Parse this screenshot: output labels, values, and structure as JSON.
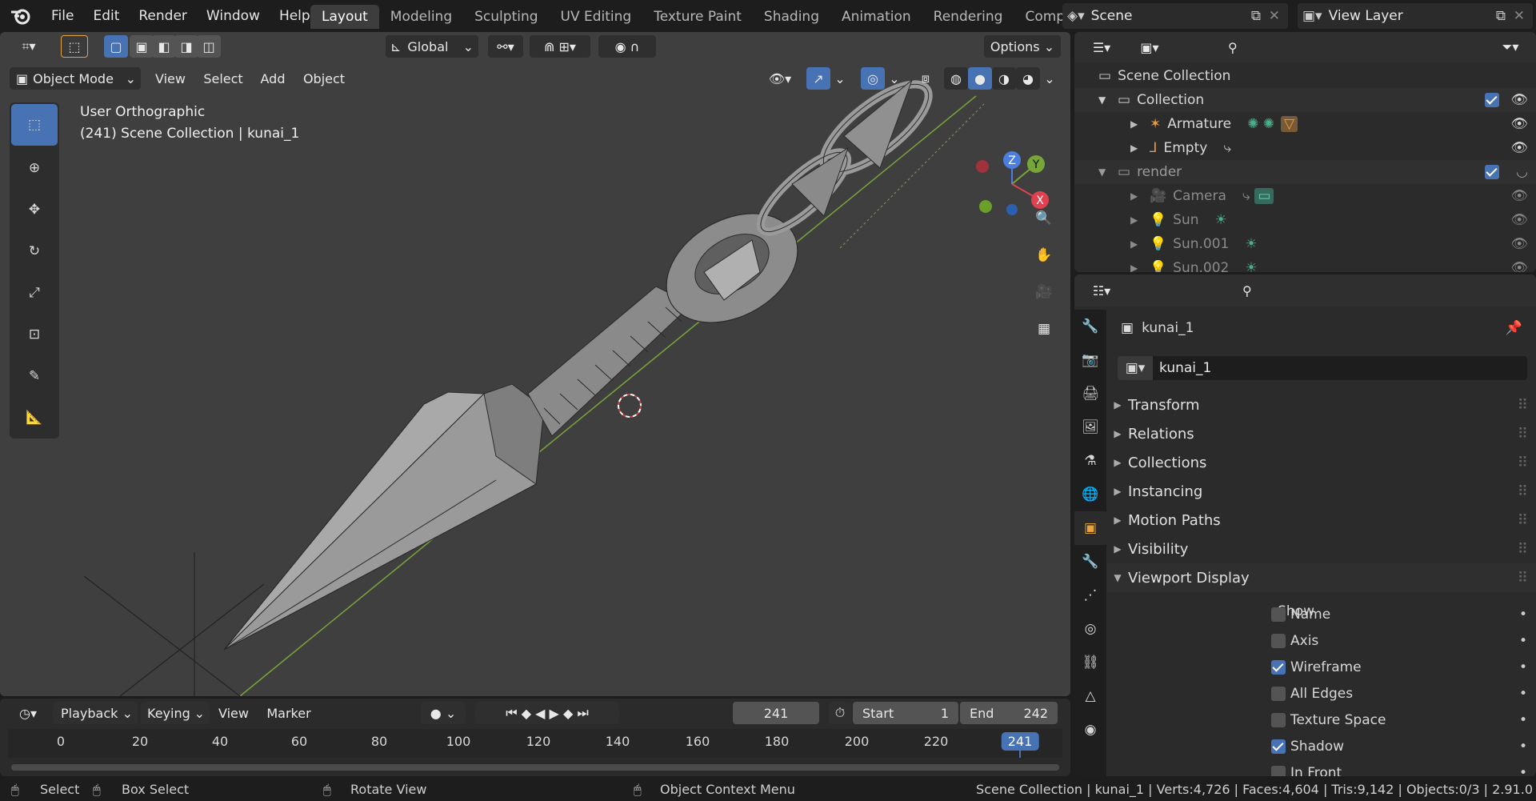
{
  "menu": {
    "items": [
      "File",
      "Edit",
      "Render",
      "Window",
      "Help"
    ]
  },
  "workspaces": [
    "Layout",
    "Modeling",
    "Sculpting",
    "UV Editing",
    "Texture Paint",
    "Shading",
    "Animation",
    "Rendering",
    "Compos"
  ],
  "scene": {
    "name": "Scene",
    "view_layer": "View Layer"
  },
  "viewport": {
    "transform_orientation": "Global",
    "options_label": "Options",
    "mode": "Object Mode",
    "menus": [
      "View",
      "Select",
      "Add",
      "Object"
    ],
    "overlay_title": "User Orthographic",
    "overlay_subtitle": "(241) Scene Collection | kunai_1",
    "gizmo": {
      "z": "Z",
      "y": "Y",
      "x": "X"
    }
  },
  "outliner": {
    "rows": [
      {
        "label": "Scene Collection",
        "indent": 0
      },
      {
        "label": "Collection",
        "indent": 1
      },
      {
        "label": "Armature",
        "indent": 2
      },
      {
        "label": "Empty",
        "indent": 2
      },
      {
        "label": "render",
        "indent": 1
      },
      {
        "label": "Camera",
        "indent": 2
      },
      {
        "label": "Sun",
        "indent": 2
      },
      {
        "label": "Sun.001",
        "indent": 2
      },
      {
        "label": "Sun.002",
        "indent": 2
      }
    ]
  },
  "properties": {
    "object_name": "kunai_1",
    "datablock_name": "kunai_1",
    "panels": [
      "Transform",
      "Relations",
      "Collections",
      "Instancing",
      "Motion Paths",
      "Visibility",
      "Viewport Display"
    ],
    "show_label": "Show",
    "checkboxes": [
      {
        "label": "Name",
        "checked": false
      },
      {
        "label": "Axis",
        "checked": false
      },
      {
        "label": "Wireframe",
        "checked": true
      },
      {
        "label": "All Edges",
        "checked": false
      },
      {
        "label": "Texture Space",
        "checked": false
      },
      {
        "label": "Shadow",
        "checked": true
      },
      {
        "label": "In Front",
        "checked": false
      }
    ]
  },
  "timeline": {
    "menus": [
      "Playback",
      "Keying",
      "View",
      "Marker"
    ],
    "current_frame": "241",
    "start_label": "Start",
    "start_value": "1",
    "end_label": "End",
    "end_value": "242",
    "ruler": [
      "0",
      "20",
      "40",
      "60",
      "80",
      "100",
      "120",
      "140",
      "160",
      "180",
      "200",
      "220",
      "241"
    ]
  },
  "statusbar": {
    "select": "Select",
    "box_select": "Box Select",
    "rotate_view": "Rotate View",
    "context_menu": "Object Context Menu",
    "stats": "Scene Collection | kunai_1 | Verts:4,726 | Faces:4,604 | Tris:9,142 | Objects:0/3 | 2.91.0"
  },
  "colors": {
    "accent": "#4772b3",
    "panel": "#2b2b2b",
    "viewport_bg": "#3f3f3f"
  }
}
